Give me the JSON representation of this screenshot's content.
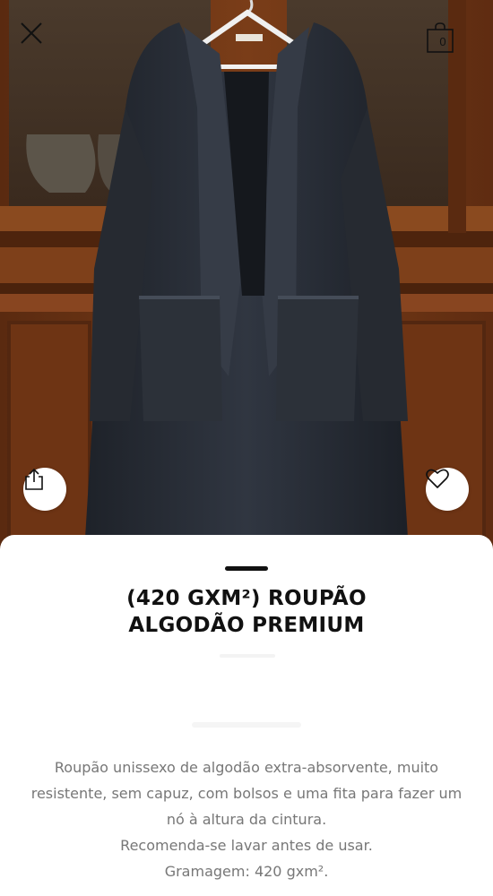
{
  "header": {
    "close_icon": "close-icon",
    "bag_icon": "shopping-bag-icon",
    "bag_count": "0"
  },
  "hero": {
    "image": "dark terry cotton bathrobe hanging on wooden cabinet",
    "share_icon": "share-icon",
    "favorite_icon": "heart-icon"
  },
  "product": {
    "title_line1": "(420 GXM²) ROUPÃO",
    "title_line2": "ALGODÃO PREMIUM",
    "description": [
      "Roupão unissexo de algodão extra-absorvente, muito",
      "resistente, sem capuz, com bolsos e uma fita para fazer um",
      "nó à altura da cintura.",
      "Recomenda-se lavar antes de usar.",
      "Gramagem: 420 gxm²."
    ]
  },
  "colors": {
    "wood": "#6b3416",
    "robe": "#2b3038",
    "text_primary": "#111111",
    "text_secondary": "#777777"
  }
}
